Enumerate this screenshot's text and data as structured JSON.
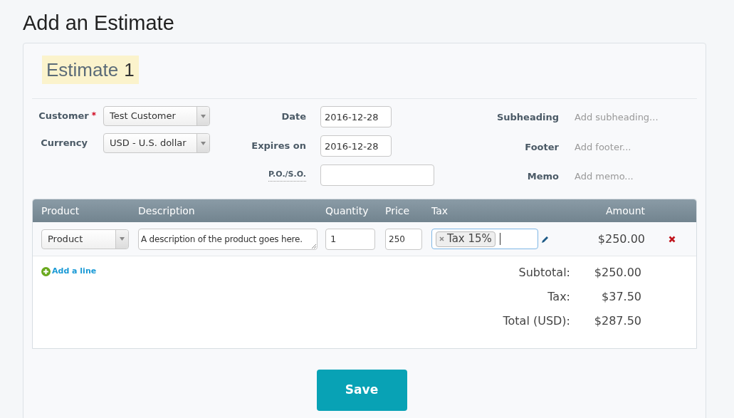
{
  "page_title": "Add an Estimate",
  "estimate": {
    "label": "Estimate",
    "number": "1"
  },
  "left_fields": [
    {
      "label": "Customer",
      "required_mark": "*",
      "value": "Test Customer"
    },
    {
      "label": "Currency",
      "value": "USD - U.S. dollar"
    }
  ],
  "middle_fields": [
    {
      "kind": "date",
      "label": "Date",
      "value": "2016-12-28"
    },
    {
      "kind": "date",
      "label": "Expires on",
      "value": "2016-12-28"
    },
    {
      "kind": "reference",
      "label": "P.O./S.O."
    }
  ],
  "right_fields": [
    {
      "label": "Subheading",
      "placeholder": "Add subheading..."
    },
    {
      "label": "Footer",
      "placeholder": "Add footer..."
    },
    {
      "label": "Memo",
      "placeholder": "Add memo..."
    }
  ],
  "table": {
    "columns": [
      "Product",
      "Description",
      "Quantity",
      "Price",
      "Tax",
      "Amount"
    ],
    "rows": [
      {
        "product": "Product",
        "description": "A description of the product goes here.",
        "quantity": "1",
        "price": "250",
        "taxes": [
          "Tax 15%"
        ],
        "amount": "$250.00"
      }
    ]
  },
  "add_line": "Add a line",
  "totals": [
    {
      "label": "Subtotal:",
      "value": "$250.00"
    },
    {
      "label": "Tax:",
      "value": "$37.50"
    },
    {
      "label": "Total (USD):",
      "value": "$287.50"
    }
  ],
  "save_button": "Save"
}
